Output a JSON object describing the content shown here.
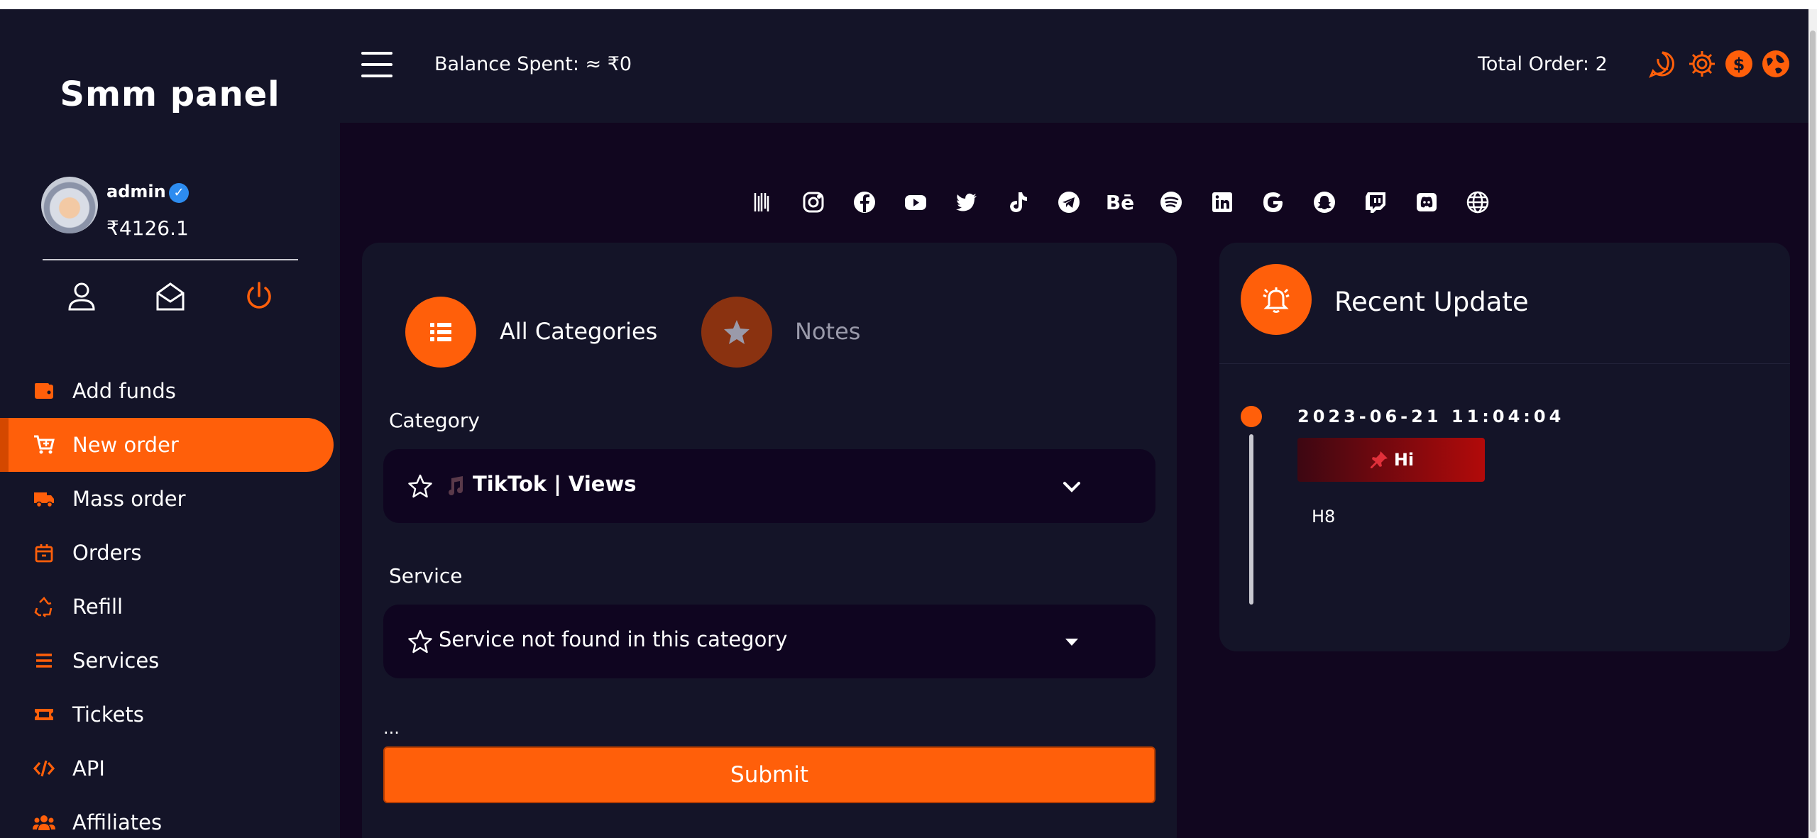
{
  "brand": {
    "title": "Smm panel"
  },
  "user": {
    "name": "admin",
    "balance": "₹4126.1",
    "verified": true
  },
  "sidebar_actions": [
    "user-icon",
    "envelope-open-icon",
    "power-icon"
  ],
  "nav": {
    "items": [
      {
        "label": "Add funds",
        "icon": "wallet-icon",
        "active": false
      },
      {
        "label": "New order",
        "icon": "cart-plus-icon",
        "active": true
      },
      {
        "label": "Mass order",
        "icon": "truck-icon",
        "active": false
      },
      {
        "label": "Orders",
        "icon": "box-icon",
        "active": false
      },
      {
        "label": "Refill",
        "icon": "recycle-icon",
        "active": false
      },
      {
        "label": "Services",
        "icon": "list-icon",
        "active": false
      },
      {
        "label": "Tickets",
        "icon": "ticket-icon",
        "active": false
      },
      {
        "label": "API",
        "icon": "code-icon",
        "active": false
      },
      {
        "label": "Affiliates",
        "icon": "users-icon",
        "active": false
      }
    ]
  },
  "header": {
    "balance_spent": "Balance Spent: ≈  ₹0",
    "total_order": "Total Order:  2",
    "icons": [
      "whatsapp-icon",
      "settings-icon",
      "dollar-icon",
      "globe-icon"
    ]
  },
  "social": [
    "barcode-icon",
    "instagram-icon",
    "facebook-icon",
    "youtube-icon",
    "twitter-icon",
    "tiktok-icon",
    "telegram-icon",
    "behance-icon",
    "spotify-icon",
    "linkedin-icon",
    "google-icon",
    "snapchat-icon",
    "twitch-icon",
    "discord-icon",
    "globe-icon"
  ],
  "behance_text": "Bē",
  "order": {
    "tab_all": "All Categories",
    "tab_notes": "Notes",
    "category_label": "Category",
    "category_value": "TikTok | Views",
    "service_label": "Service",
    "service_value": "Service not found in this category",
    "ellipsis": "...",
    "submit_label": "Submit"
  },
  "update": {
    "title": "Recent Update",
    "date": "2023-06-21 11:04:04",
    "badge": "Hi",
    "body": "H8"
  },
  "colors": {
    "accent": "#ff5f0a",
    "panel": "#141428",
    "background": "#11061f"
  }
}
